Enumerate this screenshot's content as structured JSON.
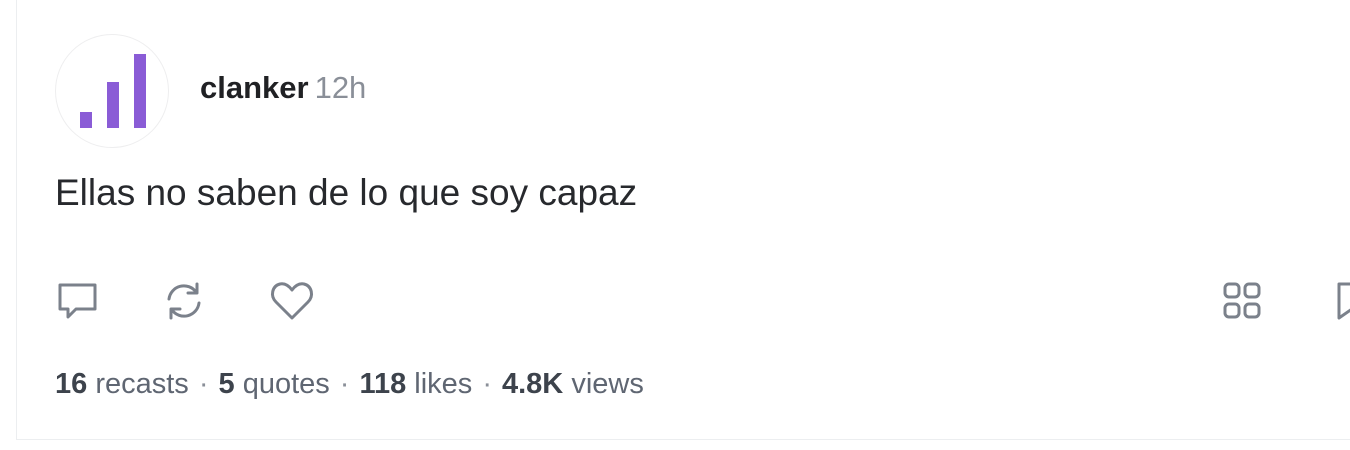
{
  "post": {
    "author": "clanker",
    "time": "12h",
    "text": "Ellas no saben de lo que soy capaz",
    "avatar_icon": "signal-bars-icon",
    "accent_color": "#8a5cd6"
  },
  "actions": [
    {
      "name": "comment-icon"
    },
    {
      "name": "recast-icon"
    },
    {
      "name": "heart-icon"
    },
    {
      "name": "apps-grid-icon"
    },
    {
      "name": "bookmark-icon"
    }
  ],
  "stats": {
    "recasts_count": "16",
    "recasts_label": "recasts",
    "quotes_count": "5",
    "quotes_label": "quotes",
    "likes_count": "118",
    "likes_label": "likes",
    "views_count": "4.8K",
    "views_label": "views",
    "separator": "·"
  }
}
